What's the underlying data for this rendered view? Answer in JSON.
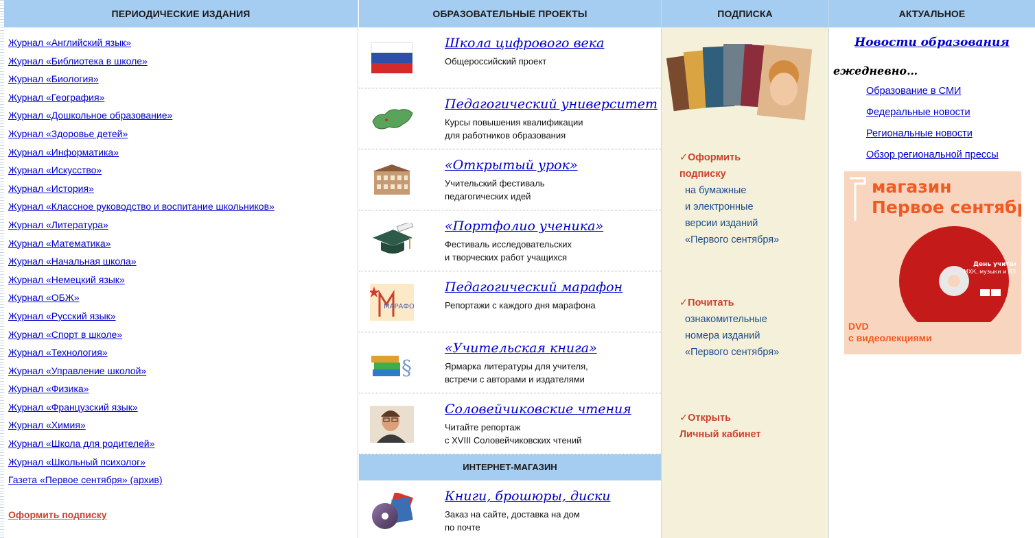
{
  "periodicals": {
    "heading": "ПЕРИОДИЧЕСКИЕ ИЗДАНИЯ",
    "items": [
      "Журнал «Английский язык»",
      "Журнал «Библиотека в школе»",
      "Журнал «Биология»",
      "Журнал «География»",
      "Журнал «Дошкольное образование»",
      "Журнал «Здоровье детей»",
      "Журнал «Информатика»",
      "Журнал «Искусство»",
      "Журнал «История»",
      "Журнал «Классное руководство и воспитание школьников»",
      "Журнал «Литература»",
      "Журнал «Математика»",
      "Журнал «Начальная школа»",
      "Журнал «Немецкий язык»",
      "Журнал «ОБЖ»",
      "Журнал «Русский язык»",
      "Журнал «Спорт в школе»",
      "Журнал «Технология»",
      "Журнал «Управление школой»",
      "Журнал «Физика»",
      "Журнал «Французский язык»",
      "Журнал «Химия»",
      "Журнал «Школа для родителей»",
      "Журнал «Школьный психолог»",
      "Газета «Первое сентября» (архив)"
    ],
    "subscribe_link": "Оформить подписку"
  },
  "projects": {
    "heading": "ОБРАЗОВАТЕЛЬНЫЕ ПРОЕКТЫ",
    "items": [
      {
        "icon": "russian-flag-icon",
        "title": "Школа цифрового века",
        "desc": "Общероссийский проект"
      },
      {
        "icon": "russia-map-icon",
        "title": "Педагогический университет",
        "desc": "Курсы повышения квалификации\nдля работников образования"
      },
      {
        "icon": "school-building-icon",
        "title": "«Открытый урок»",
        "desc": "Учительский фестиваль\nпедагогических идей"
      },
      {
        "icon": "graduation-cap-icon",
        "title": "«Портфолио ученика»",
        "desc": "Фестиваль исследовательских\nи творческих работ учащихся"
      },
      {
        "icon": "marathon-logo-icon",
        "logo_text": "МАРАФОН",
        "title": "Педагогический марафон",
        "desc": "Репортажи с каждого дня марафона"
      },
      {
        "icon": "books-icon",
        "title": "«Учительская книга»",
        "desc": "Ярмарка литературы для учителя,\nвстречи с авторами и издателями"
      },
      {
        "icon": "portrait-icon",
        "title": "Соловейчиковские чтения",
        "desc": "Читайте репортаж\nс XVIII Соловейчиковских чтений"
      }
    ],
    "shop_heading": "ИНТЕРНЕТ-МАГАЗИН",
    "shop_item": {
      "icon": "disc-books-icon",
      "title": "Книги, брошюры, диски",
      "desc": "Заказ на сайте, доставка на дом\nпо почте"
    }
  },
  "subscription": {
    "heading": "ПОДПИСКА",
    "blocks": [
      {
        "bold": "Оформить\nподписку",
        "plain": "на бумажные\nи электронные\nверсии изданий\n«Первого сентября»"
      },
      {
        "bold": "Почитать",
        "plain": "ознакомительные\nномера изданий\n«Первого сентября»"
      },
      {
        "bold": "Открыть\nЛичный кабинет",
        "plain": ""
      }
    ],
    "checkmark": "✓"
  },
  "actual": {
    "heading": "АКТУАЛЬНОЕ",
    "news_title": "Новости образования",
    "daily": "ежедневно…",
    "links": [
      "Образование в СМИ",
      "Федеральные новости",
      "Региональные новости",
      "Обзор региональной прессы"
    ],
    "banner": {
      "line1": "магазин",
      "line2": "Первое сентября",
      "dvd_line1": "DVD",
      "dvd_line2": "с видеолекциями",
      "disc_text1": "День учителя",
      "disc_text2": "МХК, музыки и ИЗО"
    }
  },
  "colors": {
    "header_bg": "#a5cdf2",
    "subscription_bg": "#f5f0d9",
    "link": "#0000cc",
    "accent": "#c8432d",
    "banner_orange": "#f15a22"
  }
}
